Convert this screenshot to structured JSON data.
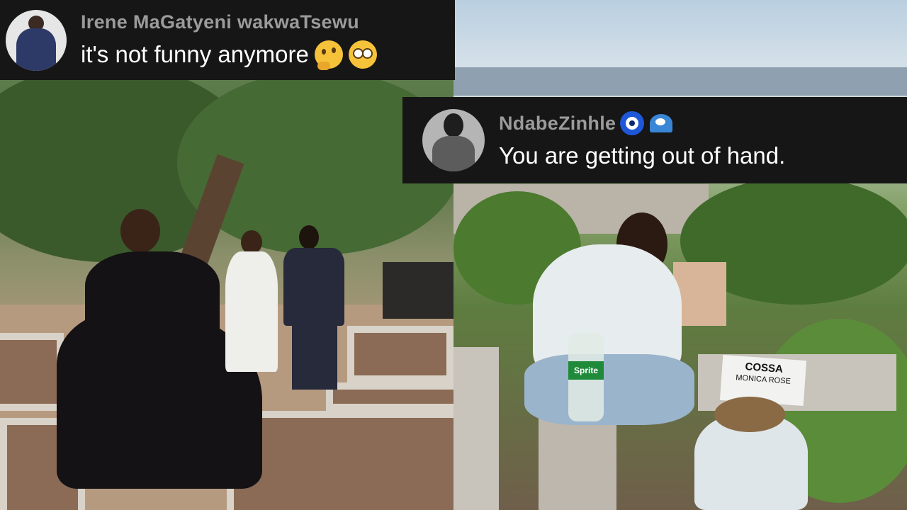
{
  "comments": [
    {
      "author": "Irene MaGatyeni wakwaTsewu",
      "text": "it's not funny anymore",
      "emojis": [
        "thinking-face-icon",
        "flushed-face-icon"
      ]
    },
    {
      "author": "NdabeZinhle",
      "author_emojis": [
        "nazar-amulet-icon",
        "water-wave-icon"
      ],
      "text": "You are getting out of hand."
    }
  ],
  "grave_marker": {
    "name": "COSSA",
    "first_names": "MONICA ROSE"
  },
  "bottle_label": "Sprite",
  "colors": {
    "overlay_bg": "#161616",
    "author_text": "#9b9b9b",
    "comment_text": "#ffffff"
  }
}
